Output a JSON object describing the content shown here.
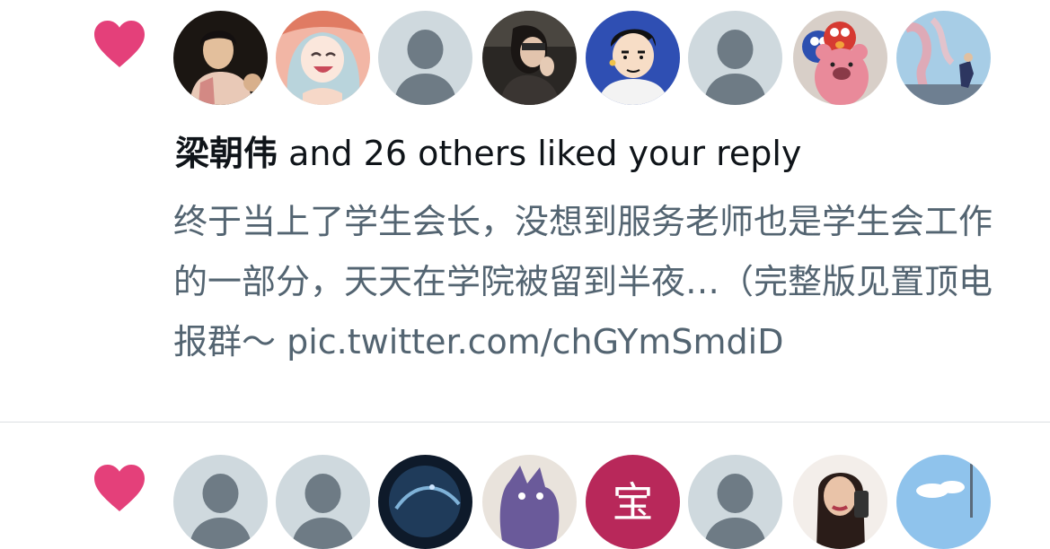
{
  "colors": {
    "heart": "#e4407a",
    "primary_text": "#0f1419",
    "secondary_text": "#536471",
    "default_avatar_bg": "#cfd9de",
    "default_avatar_fg": "#6e7b85",
    "divider": "#dcdfe2"
  },
  "notifications": [
    {
      "type": "like",
      "icon": "heart-icon",
      "avatars": [
        {
          "kind": "photo",
          "name": "avatar-1"
        },
        {
          "kind": "photo",
          "name": "avatar-2"
        },
        {
          "kind": "default",
          "name": "default-avatar"
        },
        {
          "kind": "photo",
          "name": "avatar-4"
        },
        {
          "kind": "photo",
          "name": "avatar-5"
        },
        {
          "kind": "default",
          "name": "default-avatar"
        },
        {
          "kind": "photo",
          "name": "avatar-7"
        },
        {
          "kind": "photo",
          "name": "avatar-8"
        }
      ],
      "actor_name": "梁朝伟",
      "action_text": " and 26 others liked your reply",
      "reply_text": "终于当上了学生会长，没想到服务老师也是学生会工作的一部分，天天在学院被留到半夜…（完整版见置顶电报群～ pic.twitter.com/chGYmSmdiD"
    },
    {
      "type": "like",
      "icon": "heart-icon",
      "avatars": [
        {
          "kind": "default",
          "name": "default-avatar"
        },
        {
          "kind": "default",
          "name": "default-avatar"
        },
        {
          "kind": "photo",
          "name": "avatar-3"
        },
        {
          "kind": "photo",
          "name": "avatar-4"
        },
        {
          "kind": "letter",
          "name": "letter-avatar",
          "letter": "宝"
        },
        {
          "kind": "default",
          "name": "default-avatar"
        },
        {
          "kind": "photo",
          "name": "avatar-7"
        },
        {
          "kind": "photo",
          "name": "avatar-8"
        }
      ]
    }
  ]
}
